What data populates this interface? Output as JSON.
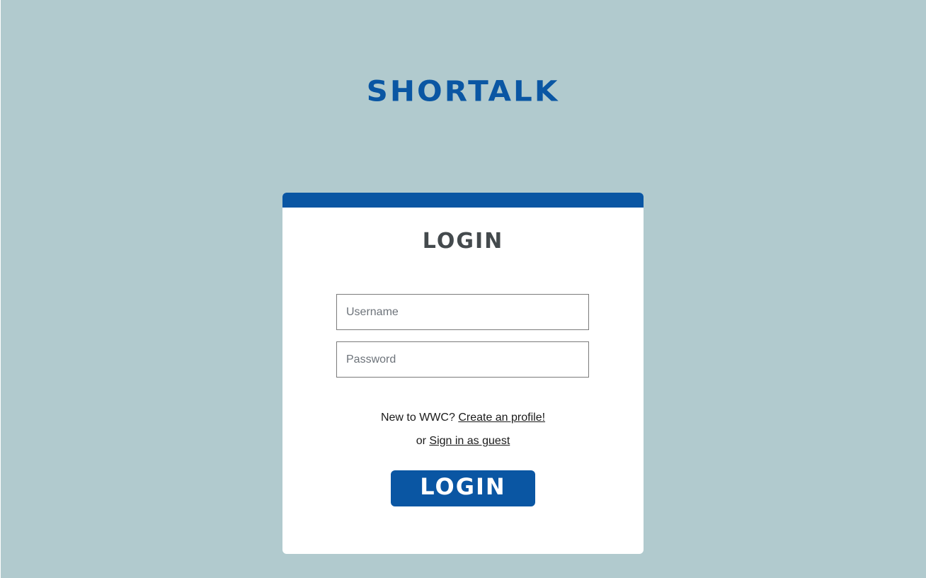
{
  "app": {
    "brand": "SHORTALK"
  },
  "login_card": {
    "title": "LOGIN",
    "username": {
      "placeholder": "Username",
      "value": ""
    },
    "password": {
      "placeholder": "Password",
      "value": ""
    },
    "signup_prompt": "New to WWC?",
    "signup_link": "Create an profile!",
    "guest_prefix": "or",
    "guest_link": "Sign in as guest",
    "submit_label": "LOGIN"
  },
  "colors": {
    "background": "#b1cace",
    "primary": "#0a56a3",
    "card": "#ffffff",
    "title_text": "#444a4d"
  }
}
